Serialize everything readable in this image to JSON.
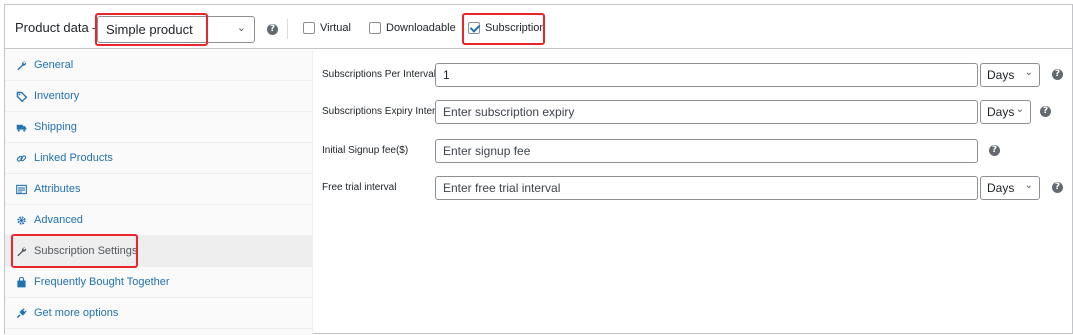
{
  "header": {
    "title": "Product data —",
    "product_type": "Simple product",
    "virtual_label": "Virtual",
    "downloadable_label": "Downloadable",
    "subscription_label": "Subscription"
  },
  "sidebar": {
    "items": [
      {
        "label": "General",
        "icon": "wrench-icon"
      },
      {
        "label": "Inventory",
        "icon": "tag-icon"
      },
      {
        "label": "Shipping",
        "icon": "truck-icon"
      },
      {
        "label": "Linked Products",
        "icon": "link-icon"
      },
      {
        "label": "Attributes",
        "icon": "list-icon"
      },
      {
        "label": "Advanced",
        "icon": "gear-icon"
      },
      {
        "label": "Subscription Settings",
        "icon": "wrench-icon"
      },
      {
        "label": "Frequently Bought Together",
        "icon": "bag-icon"
      },
      {
        "label": "Get more options",
        "icon": "plugin-icon"
      }
    ]
  },
  "fields": {
    "per_interval": {
      "label": "Subscriptions Per Interval",
      "value": "1",
      "unit": "Days"
    },
    "expiry_interval": {
      "label": "Subscriptions Expiry Interval",
      "placeholder": "Enter subscription expiry",
      "unit": "Days"
    },
    "signup_fee": {
      "label": "Initial Signup fee($)",
      "placeholder": "Enter signup fee"
    },
    "trial_interval": {
      "label": "Free trial interval",
      "placeholder": "Enter free trial interval",
      "unit": "Days"
    }
  },
  "help_glyph": "?",
  "chevron_glyph": "⌄",
  "colors": {
    "link": "#2271b1",
    "highlight": "#e8262b",
    "border": "#8c8f94"
  }
}
